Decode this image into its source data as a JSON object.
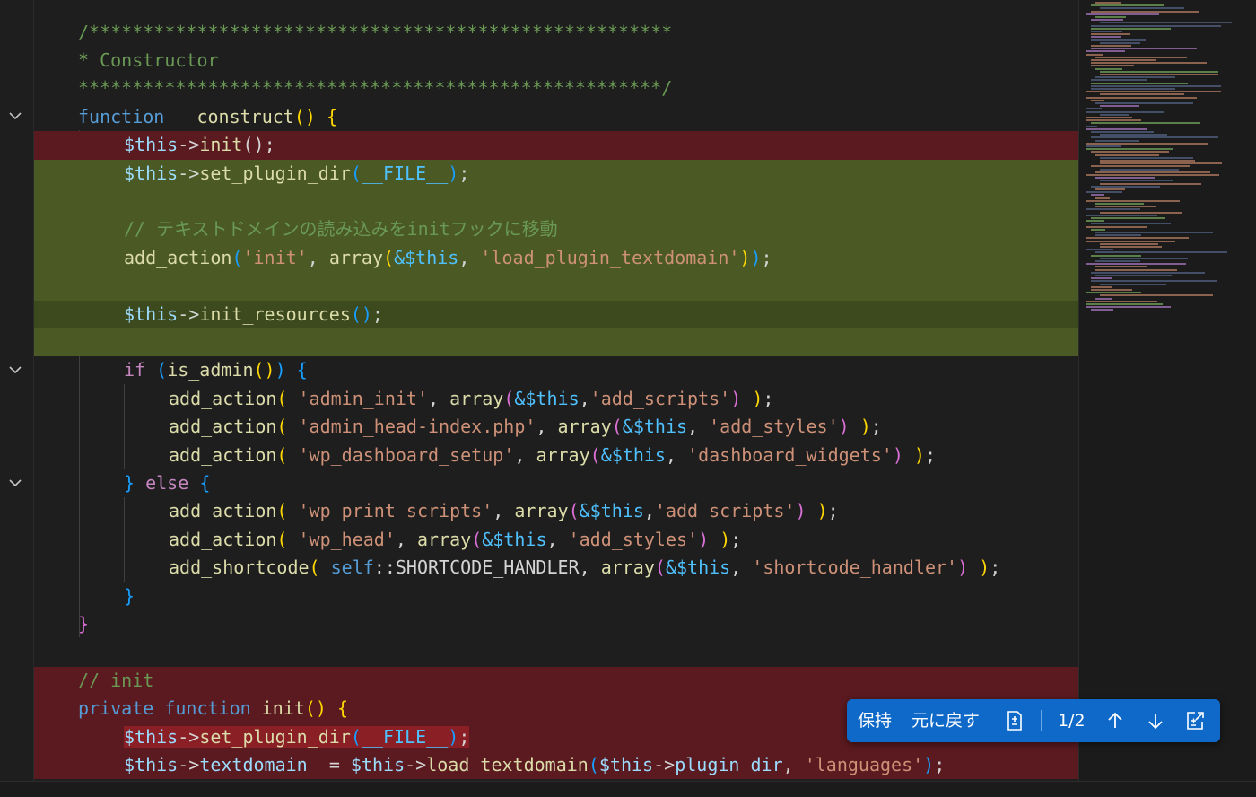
{
  "editor": {
    "lines": [
      "/******************************************************",
      "* Constructor",
      "******************************************************/",
      "function __construct() {",
      "$this->init();",
      "$this->set_plugin_dir(__FILE__);",
      "",
      "// テキストドメインの読み込みをinitフックに移動",
      "add_action('init', array(&$this, 'load_plugin_textdomain'));",
      "",
      "$this->init_resources();",
      "",
      "if (is_admin()) {",
      "add_action( 'admin_init', array(&$this,'add_scripts') );",
      "add_action( 'admin_head-index.php', array(&$this, 'add_styles') );",
      "add_action( 'wp_dashboard_setup', array(&$this, 'dashboard_widgets') );",
      "} else {",
      "add_action( 'wp_print_scripts', array(&$this,'add_scripts') );",
      "add_action( 'wp_head', array(&$this, 'add_styles') );",
      "add_shortcode( self::SHORTCODE_HANDLER, array(&$this, 'shortcode_handler') );",
      "}",
      "}",
      "",
      "// init",
      "private function init() {",
      "$this->set_plugin_dir(__FILE__);",
      "$this->textdomain  = $this->load_textdomain($this->plugin_dir, 'languages');"
    ]
  },
  "colors": {
    "background": "#1e1e1e",
    "deleted_line": "#5b1a1f",
    "inserted_line": "#4b5a24",
    "keyword": "#569cd6",
    "function": "#dcdcaa",
    "string": "#ce9178",
    "comment": "#6a9955",
    "toolbar": "#0f69c9"
  },
  "diff_toolbar": {
    "keep_label": "保持",
    "undo_label": "元に戻す",
    "counter": "1/2",
    "icons": [
      "diff-file-icon",
      "arrow-up-icon",
      "arrow-down-icon",
      "open-diff-icon"
    ]
  }
}
